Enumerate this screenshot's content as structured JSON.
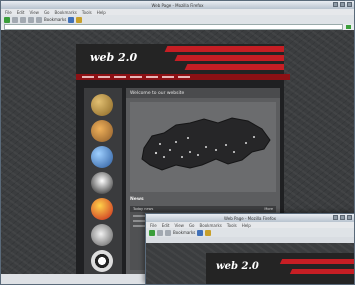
{
  "main_window": {
    "title": "Web Page - Mozilla Firefox",
    "menu": [
      "File",
      "Edit",
      "View",
      "Go",
      "Bookmarks",
      "Tools",
      "Help"
    ],
    "toolbar": {
      "bookmarks_label": "Bookmarks"
    },
    "site": {
      "logo_text": "web 2.0",
      "content_heading": "Welcome to our website",
      "section_heading": "News",
      "news_left": "Today news",
      "news_right": "More"
    }
  },
  "second_window": {
    "title": "Web Page - Mozilla Firefox",
    "menu": [
      "File",
      "Edit",
      "View",
      "Go",
      "Bookmarks",
      "Tools",
      "Help"
    ],
    "toolbar": {
      "bookmarks_label": "Bookmarks"
    },
    "logo_text": "web 2.0"
  },
  "colors": {
    "accent_red": "#c61e24",
    "nav_red": "#8d1014",
    "page_bg": "#3b3d3f",
    "toolbar_green": "#3a9e3a"
  },
  "sidebar_icons": [
    "bronze-coin-icon",
    "weather-icon",
    "globe-icon",
    "penguin-icon",
    "balloon-icon",
    "pen-icon",
    "target-icon"
  ]
}
